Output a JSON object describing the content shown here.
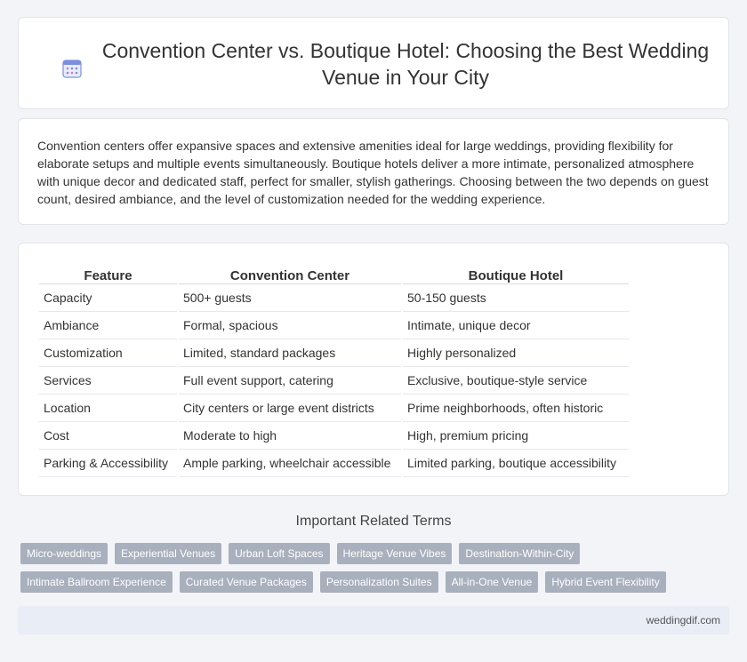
{
  "header": {
    "title": "Convention Center vs. Boutique Hotel: Choosing the Best Wedding Venue in Your City",
    "icon": "calendar-icon"
  },
  "intro": {
    "text": "Convention centers offer expansive spaces and extensive amenities ideal for large weddings, providing flexibility for elaborate setups and multiple events simultaneously. Boutique hotels deliver a more intimate, personalized atmosphere with unique decor and dedicated staff, perfect for smaller, stylish gatherings. Choosing between the two depends on guest count, desired ambiance, and the level of customization needed for the wedding experience."
  },
  "table": {
    "headers": [
      "Feature",
      "Convention Center",
      "Boutique Hotel"
    ],
    "rows": [
      [
        "Capacity",
        "500+ guests",
        "50-150 guests"
      ],
      [
        "Ambiance",
        "Formal, spacious",
        "Intimate, unique decor"
      ],
      [
        "Customization",
        "Limited, standard packages",
        "Highly personalized"
      ],
      [
        "Services",
        "Full event support, catering",
        "Exclusive, boutique-style service"
      ],
      [
        "Location",
        "City centers or large event districts",
        "Prime neighborhoods, often historic"
      ],
      [
        "Cost",
        "Moderate to high",
        "High, premium pricing"
      ],
      [
        "Parking & Accessibility",
        "Ample parking, wheelchair accessible",
        "Limited parking, boutique accessibility"
      ]
    ]
  },
  "related": {
    "title": "Important Related Terms",
    "row1": [
      "Micro-weddings",
      "Experiential Venues",
      "Urban Loft Spaces",
      "Heritage Venue Vibes",
      "Destination-Within-City"
    ],
    "row2": [
      "Intimate Ballroom Experience",
      "Curated Venue Packages",
      "Personalization Suites",
      "All-in-One Venue",
      "Hybrid Event Flexibility"
    ]
  },
  "footer": {
    "site": "weddingdif.com"
  },
  "colors": {
    "tag_bg": "#a9b0bd",
    "footer_bg": "#e9edf5",
    "page_bg": "#f3f4f7"
  }
}
